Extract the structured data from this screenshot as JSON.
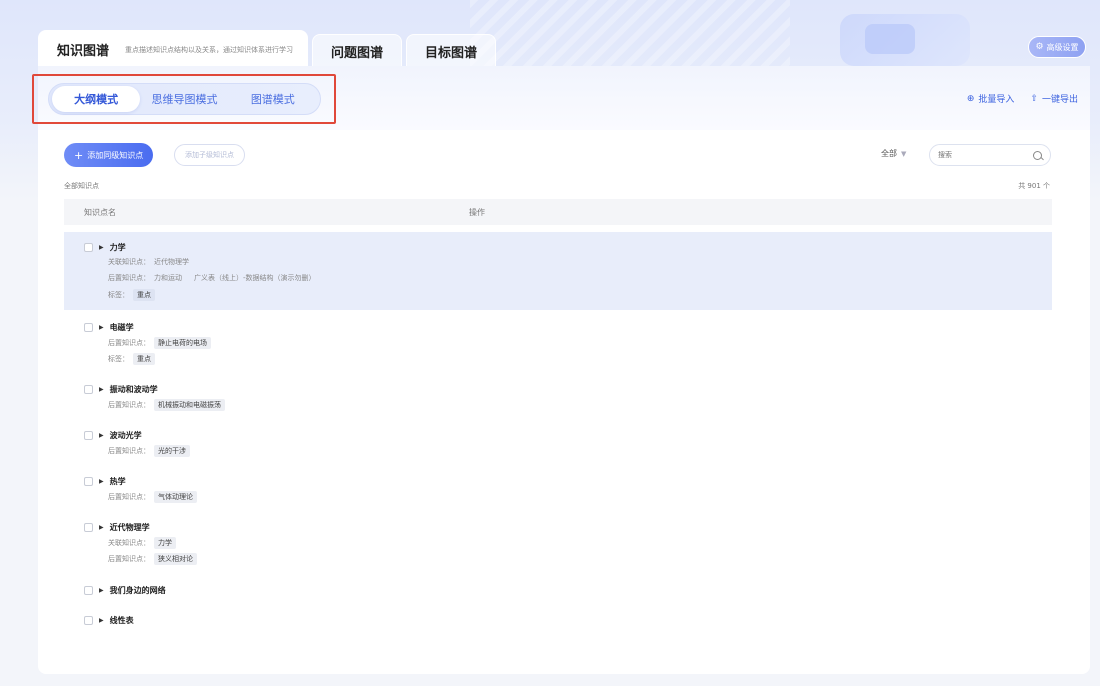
{
  "tabs": [
    {
      "label": "知识图谱",
      "subtitle": "重点描述知识点结构以及关系，通过知识体系进行学习"
    },
    {
      "label": "问题图谱"
    },
    {
      "label": "目标图谱"
    }
  ],
  "top_right": {
    "settings_label": "高级设置"
  },
  "modes": [
    "大纲模式",
    "思维导图模式",
    "图谱模式"
  ],
  "actions": {
    "batch_import": "批量导入",
    "export": "一键导出"
  },
  "toolbar": {
    "add_sibling": "添加同级知识点",
    "add_child": "添加子级知识点",
    "filter_value": "全部",
    "search_placeholder": "搜索"
  },
  "list": {
    "all_label": "全部知识点",
    "count_label": "共 901 个"
  },
  "table": {
    "col_name": "知识点名",
    "col_action": "操作"
  },
  "rows": [
    {
      "title": "力学",
      "related_label": "关联知识点：",
      "related": [
        "近代物理学"
      ],
      "post_label": "后置知识点：",
      "post": [
        "力和运动",
        "广义表（线上）-数据结构（演示勿删）"
      ],
      "tag_label": "标签：",
      "tags": [
        "重点"
      ]
    },
    {
      "title": "电磁学",
      "post_label": "后置知识点：",
      "post": [
        "静止电荷的电场"
      ],
      "tag_label": "标签：",
      "tags": [
        "重点"
      ]
    },
    {
      "title": "振动和波动学",
      "post_label": "后置知识点：",
      "post": [
        "机械振动和电磁振荡"
      ]
    },
    {
      "title": "波动光学",
      "post_label": "后置知识点：",
      "post": [
        "光的干涉"
      ]
    },
    {
      "title": "热学",
      "post_label": "后置知识点：",
      "post": [
        "气体动理论"
      ]
    },
    {
      "title": "近代物理学",
      "related_label": "关联知识点：",
      "related": [
        "力学"
      ],
      "post_label": "后置知识点：",
      "post": [
        "狭义相对论"
      ]
    },
    {
      "title": "我们身边的网络"
    },
    {
      "title": "线性表"
    }
  ],
  "colors": {
    "accent": "#4a6cf0",
    "highlight_border": "#e0483a",
    "row_highlight": "#e8edfa"
  },
  "icons": {
    "settings": "gear-icon",
    "import": "import-icon",
    "export": "export-icon",
    "search": "search-icon",
    "expand": "caret-right-icon"
  }
}
